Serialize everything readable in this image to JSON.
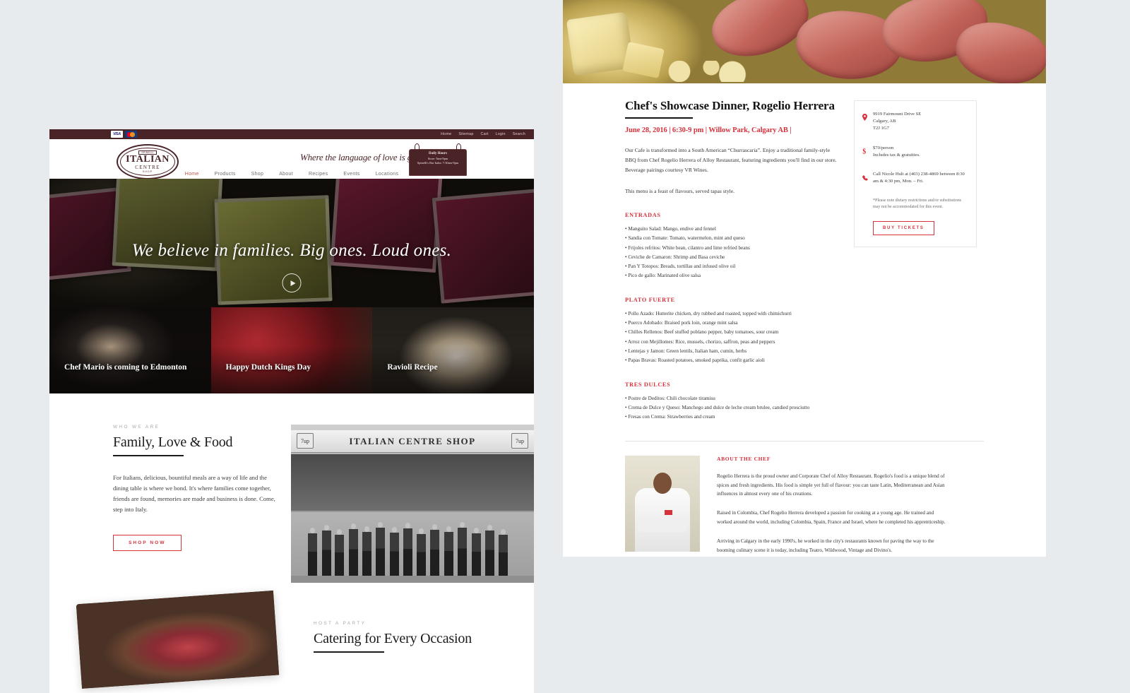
{
  "left_site": {
    "utility_bar": {
      "payment_icons": [
        "visa-icon",
        "mastercard-icon"
      ],
      "visa_label": "VISA",
      "links": [
        "Home",
        "Sitemap",
        "Cart",
        "Login",
        "Search"
      ]
    },
    "logo": {
      "crest": "SPINELLI",
      "main": "ITALIAN",
      "sub": "CENTRE",
      "shop": "SHOP"
    },
    "tagline": "Where the language of love is great food",
    "hours_sign": {
      "title": "Daily Hours",
      "line1": "Store: 9am-9pm",
      "line2": "Spinelli's Bar Italia: 7:30am-9pm"
    },
    "nav": [
      {
        "label": "Home",
        "active": true
      },
      {
        "label": "Products",
        "active": false
      },
      {
        "label": "Shop",
        "active": false
      },
      {
        "label": "About",
        "active": false
      },
      {
        "label": "Recipes",
        "active": false
      },
      {
        "label": "Events",
        "active": false
      },
      {
        "label": "Locations",
        "active": false
      }
    ],
    "hero": {
      "caption": "We believe in families. Big ones. Loud ones.",
      "play_icon": "play-icon"
    },
    "cards": [
      {
        "title": "Chef Mario is coming to Edmonton"
      },
      {
        "title": "Happy Dutch Kings Day"
      },
      {
        "title": "Ravioli Recipe"
      }
    ],
    "who_we_are": {
      "eyebrow": "WHO WE ARE",
      "heading": "Family, Love & Food",
      "body": "For Italians, delicious, bountiful meals are a way of life and the dining table is where we bond. It's where families come together, friends are found, memories are made and business is done. Come, step into Italy.",
      "cta": "SHOP NOW",
      "photo_sign": "ITALIAN CENTRE SHOP",
      "photo_brand_left": "7up",
      "photo_brand_right": "7up"
    },
    "catering": {
      "eyebrow": "HOST A PARTY",
      "heading": "Catering for Every Occasion"
    }
  },
  "right_site": {
    "title": "Chef's Showcase Dinner, Rogelio Herrera",
    "meta": "June 28, 2016  |  6:30-9 pm  |  Willow Park, Calgary AB  |",
    "intro_p1": "Our Cafe is transformed into a South American “Churrascaria”. Enjoy a traditional family-style BBQ from Chef Rogelio Herrera of Alloy Restaurant, featuring ingredients you'll find in our store. Beverage pairings courtesy VR Wines.",
    "intro_p2": "This menu is a feast of flavours, served tapas style.",
    "menu_sections": [
      {
        "heading": "ENTRADAS",
        "items": [
          "• Manguito Salad: Mango, endive and fennel",
          "• Sandia con Tomate: Tomato, watermelon, mint and queso",
          "• Frijoles refritos: White bean, cilantro and lime refried beans",
          "• Ceviche de Camaron: Shrimp and Basa ceviche",
          "• Pan Y Totopos: Breads, tortillas and infused olive oil",
          "• Pico de gallo: Marinated olive salsa"
        ]
      },
      {
        "heading": "PLATO FUERTE",
        "items": [
          "• Pollo Azado: Hutterite chicken, dry rubbed and roasted, topped with chimichurri",
          "• Puerco Adobado: Braised pork loin, orange mint salsa",
          "• Chilles Rellenos: Beef stuffed poblano pepper, baby tomatoes, sour cream",
          "• Arroz con Mejillomes: Rice, mussels, chorizo, saffron, peas and peppers",
          "• Lentejas y Jamon: Green lentils, Italian ham, cumin, herbs",
          "• Papas Bravas: Roasted potatoes, smoked paprika, confit garlic aioli"
        ]
      },
      {
        "heading": "TRES DULCES",
        "items": [
          "• Postre de Deditos: Chili chocolate tiramisu",
          "• Crema de Dulce y Queso: Manchego and dulce de leche cream brulee, candied prosciutto",
          "• Fresas con Crema: Strawberries and cream"
        ]
      }
    ],
    "aside": {
      "location_icon": "map-pin-icon",
      "location": "9919 Fairmount Drive SE\nCalgary, AB\nT2J 1G7",
      "price_icon": "dollar-icon",
      "price": "$70/person\nIncludes tax & gratuities.",
      "phone_icon": "phone-icon",
      "phone": "Call Nicole Hult at (403) 238-4869 between 8:30 am & 4:30 pm, Mon. – Fri.",
      "disclaimer": "*Please note dietary restrictions and/or substitutions may not be accommodated for this event.",
      "cta": "BUY TICKETS"
    },
    "chef": {
      "heading": "ABOUT THE CHEF",
      "p1": "Rogelio Herrera is the proud owner and Corporate Chef of Alloy Restaurant. Rogelio's food is a unique blend of spices and fresh ingredients. His food is simple yet full of flavour: you can taste Latin, Mediterranean and Asian influences in almost every one of his creations.",
      "p2": "Raised in Colombia, Chef Rogelio Herrera developed a passion for cooking at a young age. He trained and worked around the world, including Colombia, Spain, France and Israel, where he completed his apprenticeship.",
      "p3": "Arriving in Calgary in the early 1990's, he worked in the city's restaurants known for paving the way to the booming culinary scene it is today, including Teatro, Wildwood, Vintage and Divino's."
    }
  },
  "colors": {
    "brand_maroon": "#4a2327",
    "accent_red": "#d5323c",
    "page_bg": "#e8ebed"
  }
}
